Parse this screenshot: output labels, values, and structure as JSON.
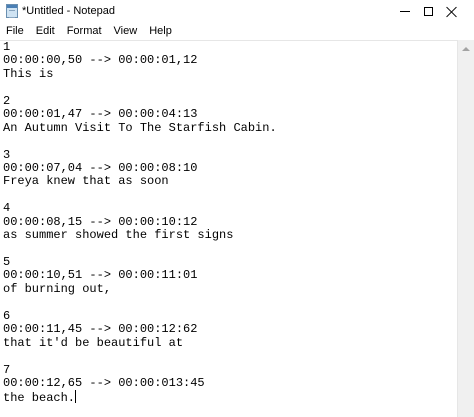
{
  "window": {
    "title": "*Untitled - Notepad",
    "icon": "notepad-icon"
  },
  "menu": {
    "items": [
      "File",
      "Edit",
      "Format",
      "View",
      "Help"
    ]
  },
  "document": {
    "lines": [
      "1",
      "00:00:00,50 --> 00:00:01,12",
      "This is",
      "",
      "2",
      "00:00:01,47 --> 00:00:04:13",
      "An Autumn Visit To The Starfish Cabin.",
      "",
      "3",
      "00:00:07,04 --> 00:00:08:10",
      "Freya knew that as soon",
      "",
      "4",
      "00:00:08,15 --> 00:00:10:12",
      "as summer showed the first signs",
      "",
      "5",
      "00:00:10,51 --> 00:00:11:01",
      "of burning out,",
      "",
      "6",
      "00:00:11,45 --> 00:00:12:62",
      "that it'd be beautiful at",
      "",
      "7",
      "00:00:12,65 --> 00:00:013:45",
      "the beach."
    ]
  }
}
